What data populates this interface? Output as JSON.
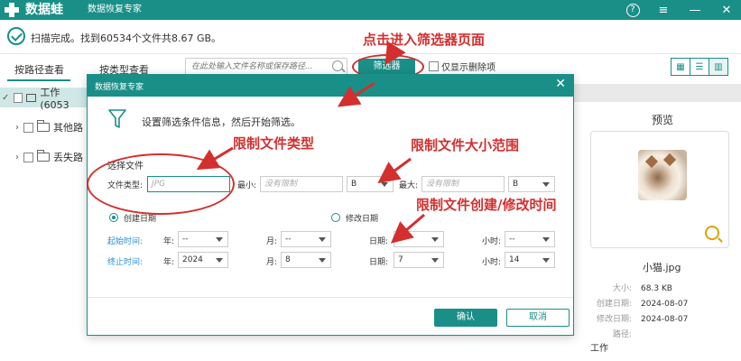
{
  "titlebar": {
    "app_name": "数据蛙",
    "subtitle": "数据恢复专家",
    "help": "?",
    "menu": "≡",
    "minimize": "—",
    "close": "✕"
  },
  "status": {
    "scan_text": "扫描完成。找到60534个文件共8.67 GB。"
  },
  "left_tabs": {
    "by_path": "按路径查看",
    "by_type": "按类型查看"
  },
  "toolbar": {
    "search_placeholder": "在此处输入文件名称或保存路径...",
    "filter_button": "筛选器",
    "show_deleted_label": "仅显示删除项",
    "view_icons": [
      "▦",
      "☰",
      "▥"
    ]
  },
  "tree": {
    "root_label": "工作 (6053",
    "items": [
      "其他路",
      "丢失路"
    ]
  },
  "preview": {
    "title": "预览",
    "file_name": "小猫.jpg",
    "size_key": "大小:",
    "size_value": "68.3 KB",
    "created_key": "创建日期:",
    "created_value": "2024-08-07",
    "modified_key": "修改日期:",
    "modified_value": "2024-08-07",
    "path_key": "路径:",
    "path_value": "工作"
  },
  "dialog": {
    "title": "数据恢复专家",
    "intro": "设置筛选条件信息，然后开始筛选。",
    "section_label": "选择文件",
    "file_type_label": "文件类型:",
    "file_type_value": "JPG",
    "min_label": "最小:",
    "min_placeholder": "没有限制",
    "min_unit": "B",
    "max_label": "最大:",
    "max_placeholder": "没有限制",
    "max_unit": "B",
    "created_date_label": "创建日期",
    "modified_date_label": "修改日期",
    "start_time_label": "起始时间:",
    "end_time_label": "终止时间:",
    "year_label": "年:",
    "month_label": "月:",
    "day_label": "日期:",
    "hour_label": "小时:",
    "start": {
      "year": "--",
      "month": "--",
      "day": "--",
      "hour": "--"
    },
    "end": {
      "year": "2024",
      "month": "8",
      "day": "7",
      "hour": "14"
    },
    "ok": "确认",
    "cancel": "取消"
  },
  "annotations": {
    "click_filter": "点击进入筛选器页面",
    "limit_type": "限制文件类型",
    "limit_size": "限制文件大小范围",
    "limit_time": "限制文件创建/修改时间"
  },
  "colors": {
    "accent": "#1a8f87",
    "annotation_red": "#d32f2f",
    "time_label_blue": "#2a8fd8"
  }
}
